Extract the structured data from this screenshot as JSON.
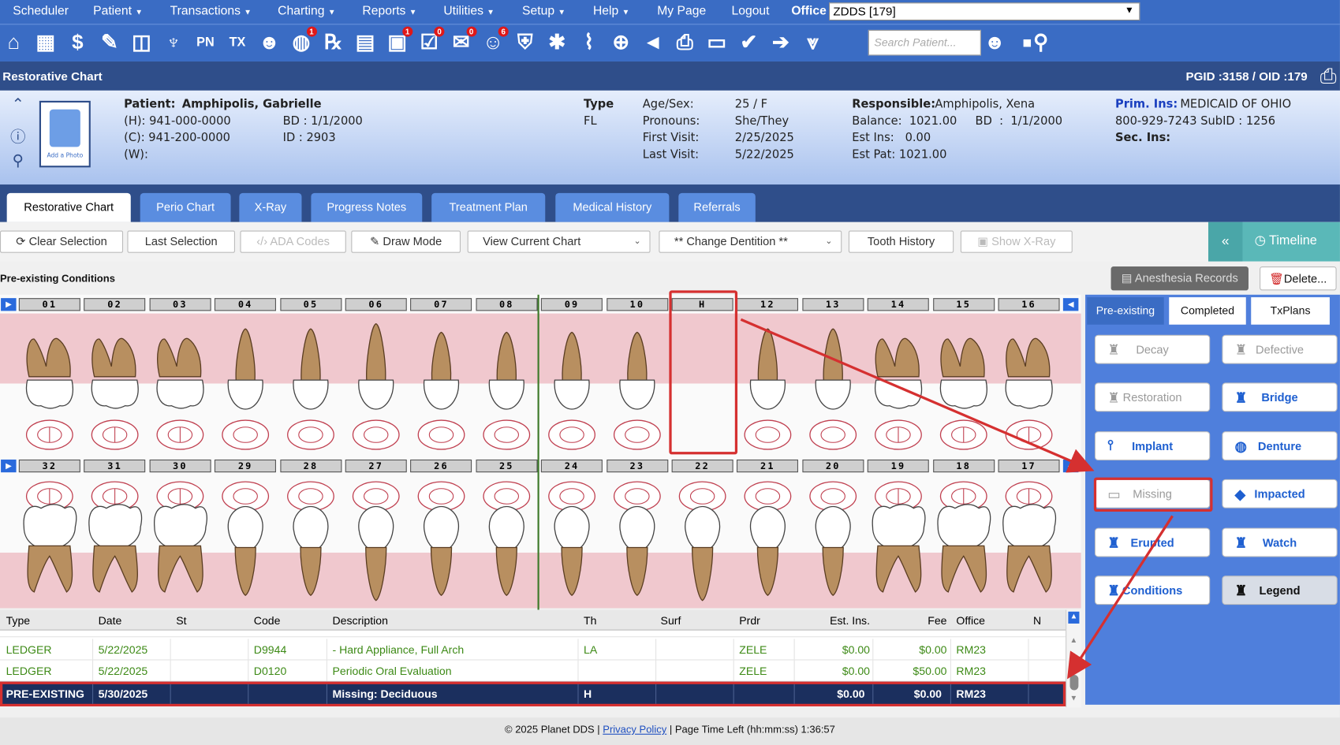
{
  "menu": {
    "items": [
      {
        "label": "Scheduler",
        "dropdown": false
      },
      {
        "label": "Patient",
        "dropdown": true
      },
      {
        "label": "Transactions",
        "dropdown": true
      },
      {
        "label": "Charting",
        "dropdown": true
      },
      {
        "label": "Reports",
        "dropdown": true
      },
      {
        "label": "Utilities",
        "dropdown": true
      },
      {
        "label": "Setup",
        "dropdown": true
      },
      {
        "label": "Help",
        "dropdown": true
      },
      {
        "label": "My Page",
        "dropdown": false
      },
      {
        "label": "Logout",
        "dropdown": false
      }
    ],
    "office_label": "Office",
    "office_value": "ZDDS [179]"
  },
  "toolbar_icons": [
    {
      "name": "home-icon",
      "glyph": "⌂",
      "badge": ""
    },
    {
      "name": "calendar-icon",
      "glyph": "▦",
      "badge": ""
    },
    {
      "name": "dollar-icon",
      "glyph": "$",
      "badge": ""
    },
    {
      "name": "edit-form-icon",
      "glyph": "✎",
      "badge": ""
    },
    {
      "name": "tooth-chart-icon",
      "glyph": "◫",
      "badge": ""
    },
    {
      "name": "perio-icon",
      "glyph": "♆",
      "badge": ""
    },
    {
      "name": "progress-notes-icon",
      "glyph": "PN",
      "badge": ""
    },
    {
      "name": "treatment-icon",
      "glyph": "TX",
      "badge": ""
    },
    {
      "name": "add-user-icon",
      "glyph": "☻",
      "badge": ""
    },
    {
      "name": "globe-users-icon",
      "glyph": "◍",
      "badge": "1"
    },
    {
      "name": "rx-icon",
      "glyph": "℞",
      "badge": ""
    },
    {
      "name": "message-icon",
      "glyph": "▤",
      "badge": ""
    },
    {
      "name": "chat-icon",
      "glyph": "▣",
      "badge": "1"
    },
    {
      "name": "checklist-icon",
      "glyph": "☑",
      "badge": "0"
    },
    {
      "name": "sms-icon",
      "glyph": "✉",
      "badge": "0"
    },
    {
      "name": "reminder-icon",
      "glyph": "☺",
      "badge": "6"
    },
    {
      "name": "insurance-shield-icon",
      "glyph": "⛨",
      "badge": ""
    },
    {
      "name": "network-icon",
      "glyph": "✱",
      "badge": ""
    },
    {
      "name": "analytics-chart-icon",
      "glyph": "⌇",
      "badge": ""
    },
    {
      "name": "web-globe-icon",
      "glyph": "⊕",
      "badge": ""
    },
    {
      "name": "megaphone-icon",
      "glyph": "◄",
      "badge": ""
    },
    {
      "name": "printer-icon",
      "glyph": "⎙",
      "badge": ""
    },
    {
      "name": "scanner-icon",
      "glyph": "▭",
      "badge": ""
    },
    {
      "name": "verify-shield-icon",
      "glyph": "✔",
      "badge": ""
    },
    {
      "name": "transfer-icon",
      "glyph": "➔",
      "badge": ""
    },
    {
      "name": "collapse-down-icon",
      "glyph": "⩔",
      "badge": ""
    }
  ],
  "search": {
    "placeholder": "Search Patient..."
  },
  "title": {
    "page": "Restorative Chart",
    "ids": "PGID :3158  /  OID :179"
  },
  "patient": {
    "name_label": "Patient:",
    "name": "Amphipolis, Gabrielle",
    "home": "(H): 941-000-0000",
    "cell": "(C):  941-200-0000",
    "work": "(W):",
    "bd": "BD  :  1/1/2000",
    "id": "ID  :  2903",
    "add_photo": "Add a Photo",
    "type_label": "Type",
    "type_value": "FL",
    "age_sex_label": "Age/Sex:",
    "age_sex": "25 / F",
    "pronouns_label": "Pronouns:",
    "pronouns": "She/They",
    "first_visit_label": "First Visit:",
    "first_visit": "2/25/2025",
    "last_visit_label": "Last Visit:",
    "last_visit": "5/22/2025",
    "responsible_label": "Responsible:",
    "responsible": "Amphipolis, Xena",
    "balance": "Balance:  1021.00     BD  :  1/1/2000",
    "est_ins": "Est Ins:   0.00",
    "est_pat": "Est Pat:  1021.00",
    "prim_ins_label": "Prim. Ins:",
    "prim_ins": "MEDICAID OF OHIO",
    "prim_ins_detail": "800-929-7243 SubID : 1256",
    "sec_ins_label": "Sec. Ins:"
  },
  "tabs": [
    "Restorative Chart",
    "Perio Chart",
    "X-Ray",
    "Progress Notes",
    "Treatment Plan",
    "Medical History",
    "Referrals"
  ],
  "tools": {
    "clear_selection": "Clear Selection",
    "last_selection": "Last Selection",
    "ada_codes": "ADA Codes",
    "draw_mode": "Draw Mode",
    "view_current_chart": "View Current Chart",
    "change_dentition": "** Change Dentition **",
    "tooth_history": "Tooth History",
    "show_xray": "Show X-Ray",
    "timeline": "Timeline"
  },
  "section_label": "Pre-existing Conditions",
  "upper_teeth": [
    "01",
    "02",
    "03",
    "04",
    "05",
    "06",
    "07",
    "08",
    "09",
    "10",
    "H",
    "12",
    "13",
    "14",
    "15",
    "16"
  ],
  "lower_teeth": [
    "32",
    "31",
    "30",
    "29",
    "28",
    "27",
    "26",
    "25",
    "24",
    "23",
    "22",
    "21",
    "20",
    "19",
    "18",
    "17"
  ],
  "side_panel": {
    "anesthesia": "Anesthesia Records",
    "delete": "Delete...",
    "tabs": [
      "Pre-existing",
      "Completed",
      "TxPlans"
    ],
    "buttons": [
      {
        "label": "Decay",
        "style": "dim"
      },
      {
        "label": "Defective",
        "style": "dim"
      },
      {
        "label": "Restoration",
        "style": "dim"
      },
      {
        "label": "Bridge",
        "style": "blue"
      },
      {
        "label": "Implant",
        "style": "blue"
      },
      {
        "label": "Denture",
        "style": "blue"
      },
      {
        "label": "Missing",
        "style": "dim"
      },
      {
        "label": "Impacted",
        "style": "blue"
      },
      {
        "label": "Erupted",
        "style": "blue"
      },
      {
        "label": "Watch",
        "style": "blue"
      },
      {
        "label": "Conditions",
        "style": "blue"
      },
      {
        "label": "Legend",
        "style": "legend"
      }
    ]
  },
  "grid": {
    "headers": [
      "Type",
      "Date",
      "St",
      "Code",
      "Description",
      "Th",
      "Surf",
      "Prdr",
      "Est. Ins.",
      "Fee",
      "Office",
      "N"
    ],
    "rows": [
      {
        "type": "LEDGER",
        "date": "5/22/2025",
        "st": "",
        "code": "D9944",
        "desc": "- Hard Appliance, Full Arch",
        "th": "LA",
        "surf": "",
        "prdr": "ZELE",
        "est": "$0.00",
        "fee": "$0.00",
        "office": "RM23",
        "n": ""
      },
      {
        "type": "LEDGER",
        "date": "5/22/2025",
        "st": "",
        "code": "D0120",
        "desc": "Periodic Oral Evaluation",
        "th": "",
        "surf": "",
        "prdr": "ZELE",
        "est": "$0.00",
        "fee": "$50.00",
        "office": "RM23",
        "n": ""
      },
      {
        "type": "PRE-EXISTING",
        "date": "5/30/2025",
        "st": "",
        "code": "",
        "desc": "Missing: Deciduous",
        "th": "H",
        "surf": "",
        "prdr": "",
        "est": "$0.00",
        "fee": "$0.00",
        "office": "RM23",
        "n": ""
      }
    ]
  },
  "footer": {
    "copyright": "© 2025 Planet DDS |",
    "privacy": "Privacy Policy",
    "time_left": "| Page Time Left (hh:mm:ss) 1:36:57"
  }
}
